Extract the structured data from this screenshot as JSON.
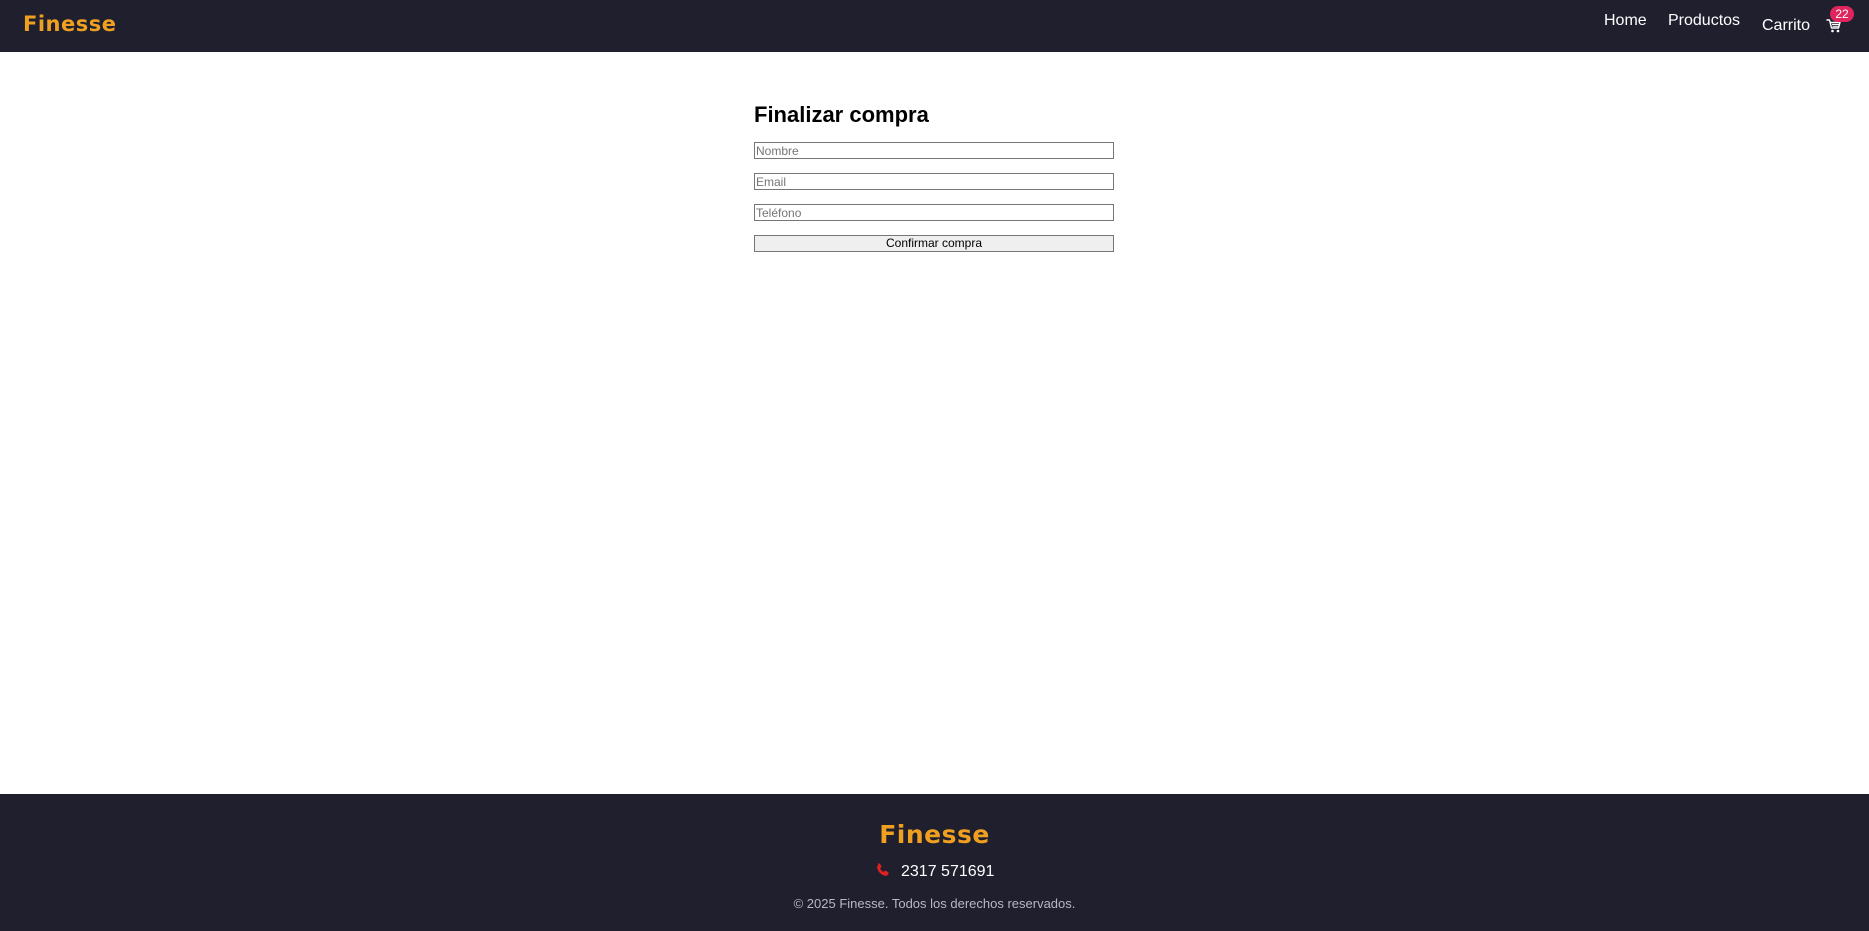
{
  "header": {
    "brand": "Finesse",
    "nav": {
      "home": "Home",
      "products": "Productos",
      "cart": "Carrito"
    },
    "cart_icon": "shopping-cart-icon",
    "cart_count": "22"
  },
  "checkout": {
    "title": "Finalizar compra",
    "name_placeholder": "Nombre",
    "email_placeholder": "Email",
    "phone_placeholder": "Teléfono",
    "confirm_label": "Confirmar compra"
  },
  "footer": {
    "brand": "Finesse",
    "phone_icon": "phone-icon",
    "phone": "2317 571691",
    "copyright": "© 2025 Finesse. Todos los derechos reservados."
  },
  "colors": {
    "bar_background": "#1f1f2e",
    "brand_accent": "#f0a020",
    "badge": "#e0245e",
    "phone_icon": "#e02020"
  }
}
